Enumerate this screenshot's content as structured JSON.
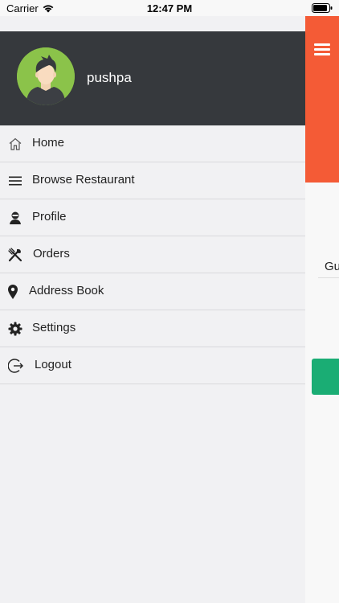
{
  "status_bar": {
    "carrier": "Carrier",
    "time": "12:47 PM"
  },
  "drawer": {
    "username": "pushpa",
    "items": [
      {
        "label": "Home",
        "icon": "home-icon"
      },
      {
        "label": "Browse Restaurant",
        "icon": "list-icon"
      },
      {
        "label": "Profile",
        "icon": "user-icon"
      },
      {
        "label": "Orders",
        "icon": "fork-knife-icon"
      },
      {
        "label": "Address Book",
        "icon": "location-pin-icon"
      },
      {
        "label": "Settings",
        "icon": "gear-icon"
      },
      {
        "label": "Logout",
        "icon": "logout-icon"
      }
    ]
  },
  "background_app": {
    "visible_text": "Gu"
  },
  "colors": {
    "header_dark": "#36393d",
    "accent_orange": "#f45b36",
    "accent_green": "#1aad74",
    "avatar_green": "#8bc34a"
  }
}
